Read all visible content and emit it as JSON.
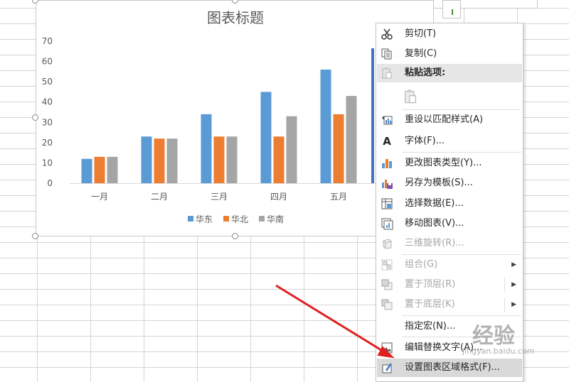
{
  "chart_data": {
    "type": "bar",
    "title": "图表标题",
    "categories": [
      "一月",
      "二月",
      "三月",
      "四月",
      "五月"
    ],
    "series": [
      {
        "name": "华东",
        "color": "#5b9bd5",
        "values": [
          12,
          23,
          34,
          45,
          56
        ]
      },
      {
        "name": "华北",
        "color": "#ed7d31",
        "values": [
          13,
          22,
          23,
          23,
          34
        ]
      },
      {
        "name": "华南",
        "color": "#a5a5a5",
        "values": [
          13,
          22,
          23,
          33,
          43
        ]
      }
    ],
    "yticks": [
      "0",
      "10",
      "20",
      "30",
      "40",
      "50",
      "60",
      "70"
    ],
    "ylim": [
      0,
      70
    ],
    "legend": "bottom",
    "grid": false
  },
  "menu": {
    "items": [
      {
        "label": "剪切(T)",
        "icon": "scissors-icon",
        "disabled": false
      },
      {
        "label": "复制(C)",
        "icon": "copy-icon",
        "disabled": false
      },
      {
        "label": "粘贴选项:",
        "icon": "paste-icon",
        "disabled": false,
        "header": true
      },
      {
        "label": "",
        "icon": "paste-option-icon",
        "disabled": false
      },
      {
        "label": "重设以匹配样式(A)",
        "icon": "reset-style-icon",
        "disabled": false
      },
      {
        "label": "字体(F)...",
        "icon": "font-icon",
        "disabled": false,
        "glyph": "A"
      },
      {
        "label": "更改图表类型(Y)...",
        "icon": "change-chart-type-icon",
        "disabled": false
      },
      {
        "label": "另存为模板(S)...",
        "icon": "save-template-icon",
        "disabled": false
      },
      {
        "label": "选择数据(E)...",
        "icon": "select-data-icon",
        "disabled": false
      },
      {
        "label": "移动图表(V)...",
        "icon": "move-chart-icon",
        "disabled": false
      },
      {
        "label": "三维旋转(R)...",
        "icon": "rotate-3d-icon",
        "disabled": true
      },
      {
        "label": "组合(G)",
        "icon": "group-icon",
        "disabled": true
      },
      {
        "label": "置于顶层(R)",
        "icon": "bring-front-icon",
        "disabled": true
      },
      {
        "label": "置于底层(K)",
        "icon": "send-back-icon",
        "disabled": true
      },
      {
        "label": "指定宏(N)...",
        "icon": "",
        "disabled": false
      },
      {
        "label": "编辑替换文字(A)...",
        "icon": "alt-text-icon",
        "disabled": false
      },
      {
        "label": "设置图表区域格式(F)...",
        "icon": "format-chart-area-icon",
        "disabled": false,
        "highlighted": true
      }
    ]
  },
  "watermark": {
    "text": "经验",
    "sub": "jingyan.baidu.com"
  }
}
